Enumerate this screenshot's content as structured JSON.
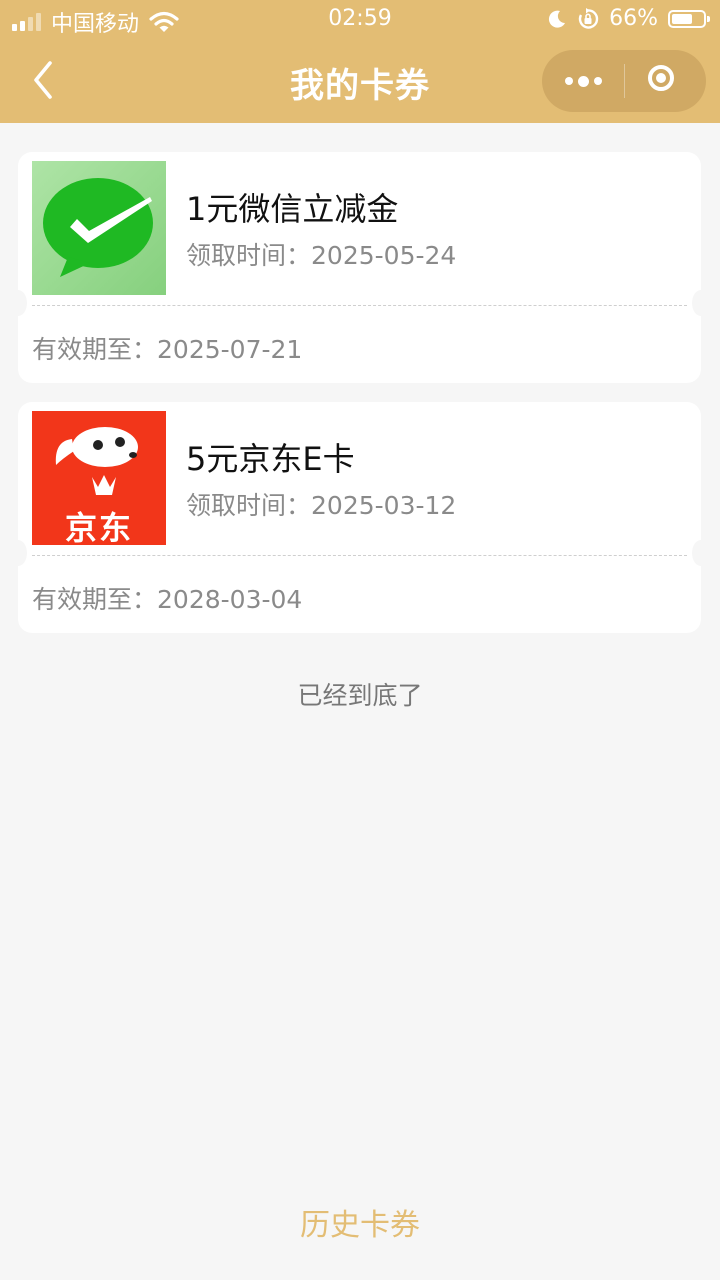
{
  "status_bar": {
    "carrier": "中国移动",
    "time": "02:59",
    "battery": "66%",
    "battery_level": 0.66
  },
  "nav": {
    "title": "我的卡券",
    "back_icon": "chevron-left-icon",
    "more_icon": "more-dots-icon",
    "close_icon": "target-circle-icon"
  },
  "coupons": [
    {
      "name": "1元微信立减金",
      "received_label": "领取时间：",
      "received_date": "2025-05-24",
      "valid_label": "有效期至：",
      "valid_date": "2025-07-21",
      "logo": "wechat-logo-icon"
    },
    {
      "name": "5元京东E卡",
      "received_label": "领取时间：",
      "received_date": "2025-03-12",
      "valid_label": "有效期至：",
      "valid_date": "2028-03-04",
      "logo": "jd-logo-icon",
      "logo_text": "京东"
    }
  ],
  "list_end_text": "已经到底了",
  "history_button": "历史卡券",
  "colors": {
    "accent": "#e3bd74",
    "background": "#f6f6f6",
    "jd_red": "#f2361a",
    "wechat_green": "#1fb923"
  }
}
